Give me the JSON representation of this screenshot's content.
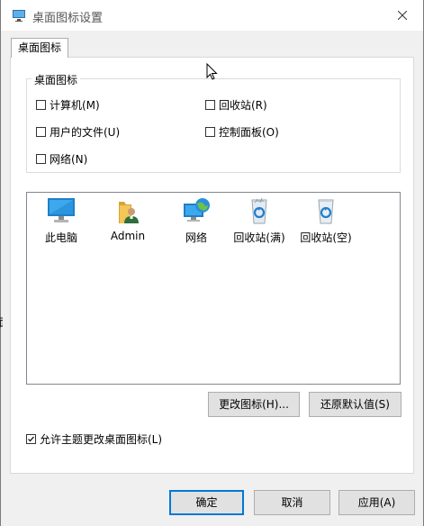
{
  "window": {
    "title": "桌面图标设置"
  },
  "tab": {
    "label": "桌面图标"
  },
  "group": {
    "title": "桌面图标",
    "checkboxes": [
      {
        "label": "计算机(M)",
        "checked": false
      },
      {
        "label": "回收站(R)",
        "checked": false
      },
      {
        "label": "用户的文件(U)",
        "checked": false
      },
      {
        "label": "控制面板(O)",
        "checked": false
      },
      {
        "label": "网络(N)",
        "checked": false
      }
    ]
  },
  "icons": [
    {
      "label": "此电脑",
      "icon": "monitor-icon"
    },
    {
      "label": "Admin",
      "icon": "user-folder-icon"
    },
    {
      "label": "网络",
      "icon": "network-icon"
    },
    {
      "label": "回收站(满)",
      "icon": "recycle-bin-full-icon"
    },
    {
      "label": "回收站(空)",
      "icon": "recycle-bin-empty-icon"
    }
  ],
  "buttons": {
    "change_icon": "更改图标(H)...",
    "restore_default": "还原默认值(S)",
    "ok": "确定",
    "cancel": "取消",
    "apply": "应用(A)"
  },
  "allow_theme": {
    "label": "允许主题更改桌面图标(L)",
    "checked": true
  },
  "edge_text": "面",
  "colors": {
    "accent": "#0078d7",
    "monitor": "#2e9ee6",
    "folder": "#e8b33c"
  }
}
